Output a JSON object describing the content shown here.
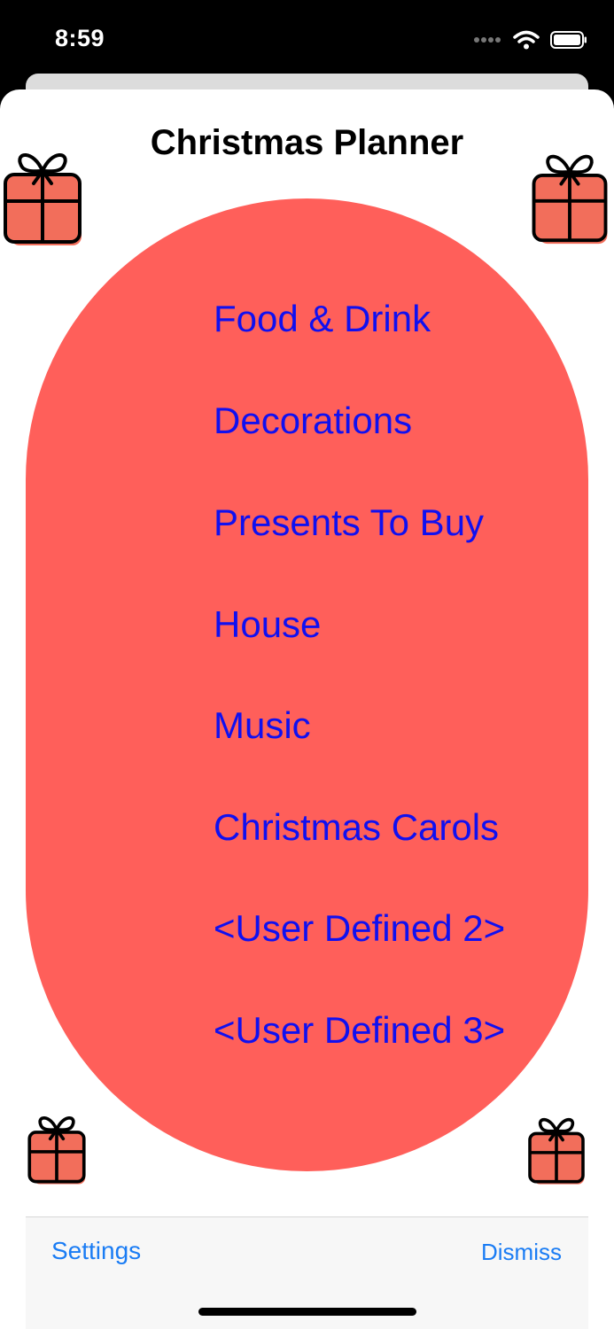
{
  "status_bar": {
    "time": "8:59"
  },
  "app": {
    "title": "Christmas Planner"
  },
  "menu": {
    "items": [
      {
        "label": "Food & Drink"
      },
      {
        "label": "Decorations"
      },
      {
        "label": "Presents To Buy"
      },
      {
        "label": "House"
      },
      {
        "label": "Music"
      },
      {
        "label": "Christmas Carols"
      },
      {
        "label": "<User Defined 2>"
      },
      {
        "label": "<User Defined 3>"
      }
    ]
  },
  "toolbar": {
    "settings_label": "Settings",
    "dismiss_label": "Dismiss"
  },
  "colors": {
    "oval": "#ff5f5a",
    "menu_text": "#1010f0",
    "toolbar_link": "#1a7cf4",
    "gift_fill": "#f26e5b"
  },
  "icons": {
    "gift": "gift-icon"
  }
}
